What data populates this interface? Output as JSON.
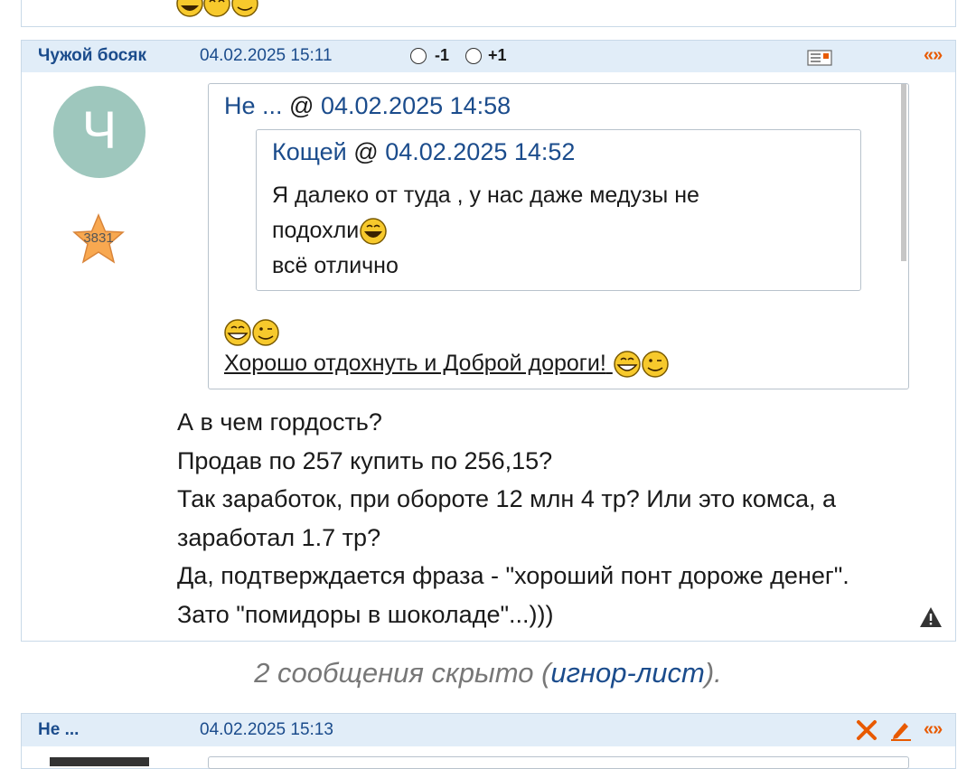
{
  "colors": {
    "header_bg": "#e1edf8",
    "link": "#1b4c8c",
    "accent": "#e85a00",
    "avatar_bg": "#9ec7bd"
  },
  "post": {
    "author": "Чужой босяк",
    "datetime": "04.02.2025 15:11",
    "vote_minus": "-1",
    "vote_plus": "+1",
    "nav": "«»",
    "avatar_letter": "Ч",
    "rating": "3831",
    "quote": {
      "author": "Не ...",
      "at": "@",
      "datetime": "04.02.2025 14:58",
      "nested": {
        "author": "Кощей",
        "at": "@",
        "datetime": "04.02.2025 14:52",
        "line1": "Я далеко от туда , у нас даже медузы не",
        "line2": "подохли",
        "line3": "всё отлично"
      },
      "tail_link": "Хорошо отдохнуть и Доброй дороги!"
    },
    "body": [
      "А в чем гордость?",
      "Продав по 257 купить по 256,15?",
      "Так заработок, при обороте 12 млн 4 тр? Или это комса, а",
      "заработал 1.7 тр?",
      "Да, подтверждается фраза - \"хороший понт дороже денег\".",
      "Зато \"помидоры в шоколаде\"...)))"
    ]
  },
  "hidden": {
    "prefix": "2 сообщения скрыто (",
    "link": "игнор-лист",
    "suffix": ")."
  },
  "post2": {
    "author": "Не ...",
    "datetime": "04.02.2025 15:13",
    "nav": "«»"
  }
}
